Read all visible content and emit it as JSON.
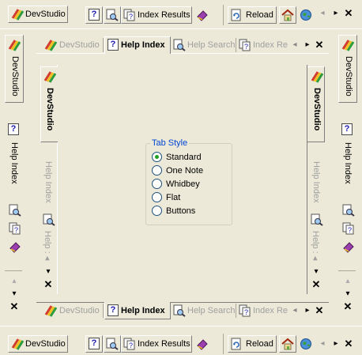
{
  "toolbar": {
    "devstudio": "DevStudio",
    "index_results": "Index Results",
    "reload": "Reload",
    "arrow_left": "◂",
    "arrow_right": "▸",
    "close": "✕",
    "help_glyph": "?"
  },
  "tabs": {
    "devstudio": "DevStudio",
    "help_index": "Help Index",
    "help_search": "Help Search",
    "index_results_cut": "Index Re",
    "help_cut": "Help : ◂",
    "arrow_down": "▾",
    "arrow_left": "◂",
    "close": "✕"
  },
  "tab_style": {
    "title": "Tab Style",
    "options": [
      "Standard",
      "One Note",
      "Whidbey",
      "Flat",
      "Buttons"
    ],
    "selected": "Standard"
  },
  "colors": {
    "background": "#ece9d8",
    "group_title": "#0046d5",
    "radio_border": "#1c5180",
    "radio_dot": "#21a121"
  }
}
